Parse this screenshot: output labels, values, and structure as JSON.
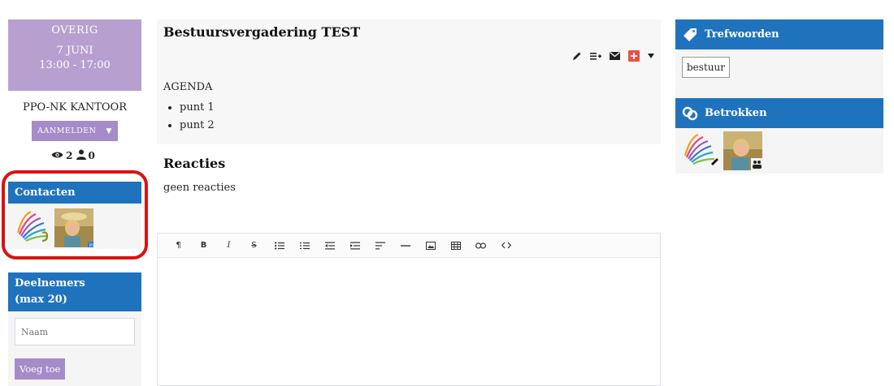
{
  "event": {
    "category": "OVERIG",
    "date": "7 JUNI",
    "time": "13:00 - 17:00",
    "location": "PPO-NK KANTOOR",
    "signup_label": "AANMELDEN",
    "views_count": "2",
    "attendees_count": "0"
  },
  "contacts": {
    "title": "Contacten"
  },
  "participants": {
    "title_line1": "Deelnemers",
    "title_line2": "(max 20)",
    "name_placeholder": "Naam",
    "add_label": "Voeg toe"
  },
  "main": {
    "title": "Bestuursvergadering TEST",
    "agenda_label": "AGENDA",
    "agenda_items": [
      "punt 1",
      "punt 2"
    ],
    "reactions_title": "Reacties",
    "no_reactions": "geen reacties"
  },
  "editor_toolbar": {
    "paragraph": "¶",
    "bold": "B",
    "italic": "I",
    "strike": "S"
  },
  "keywords": {
    "title": "Trefwoorden",
    "tags": [
      "bestuur"
    ]
  },
  "involved": {
    "title": "Betrokken"
  },
  "colors": {
    "panel_blue": "#1f73bd",
    "event_purple": "#b7a0d0",
    "button_purple": "#a68bc9",
    "highlight_red": "#dd1111"
  }
}
